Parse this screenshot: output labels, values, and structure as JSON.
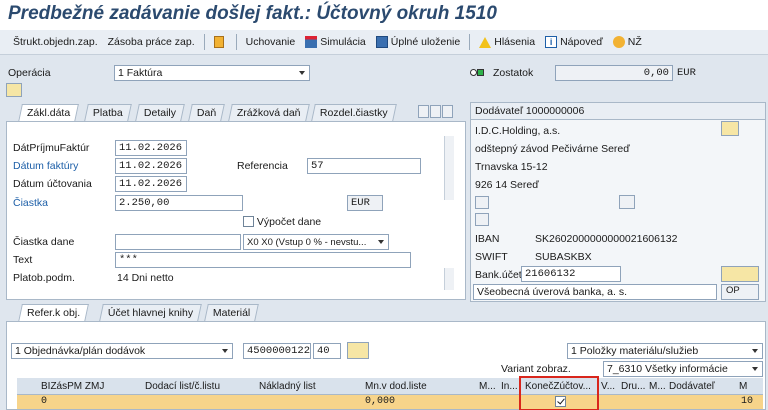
{
  "title": "Predbežné zadávanie došlej fakt.: Účtovný okruh 1510",
  "toolbar": {
    "items": [
      {
        "label": "Štrukt.objedn.zap."
      },
      {
        "label": "Zásoba práce zap."
      },
      {
        "label": "Uchovanie"
      },
      {
        "label": "Simulácia"
      },
      {
        "label": "Úplné uloženie"
      },
      {
        "label": "Hlásenia"
      },
      {
        "label": "Nápoveď"
      },
      {
        "label": "NŽ"
      }
    ]
  },
  "header": {
    "operation_label": "Operácia",
    "operation_value": "1 Faktúra",
    "balance_label": "Zostatok",
    "balance_value": "0,00",
    "balance_currency": "EUR"
  },
  "tabs": {
    "labels": [
      "Zákl.dáta",
      "Platba",
      "Detaily",
      "Daň",
      "Zrážková daň",
      "Rozdel.čiastky"
    ]
  },
  "basic": {
    "invoice_receipt_date_label": "DátPríjmuFaktúr",
    "invoice_receipt_date_value": "11.02.2026",
    "invoice_date_label": "Dátum faktúry",
    "invoice_date_value": "11.02.2026",
    "reference_label": "Referencia",
    "reference_value": "57",
    "posting_date_label": "Dátum účtovania",
    "posting_date_value": "11.02.2026",
    "amount_label": "Čiastka",
    "amount_value": "2.250,00",
    "amount_currency": "EUR",
    "calc_tax_label": "Výpočet dane",
    "tax_amount_label": "Čiastka dane",
    "tax_code_value": "X0 X0 (Vstup 0 % - nevstu...",
    "text_label": "Text",
    "text_value": "***",
    "payment_terms_label": "Platob.podm.",
    "payment_terms_value": "14 Dni netto"
  },
  "vendor": {
    "heading": "Dodávateľ 1000000006",
    "name": "I.D.C.Holding, a.s.",
    "branch": "odštepný závod Pečivárne Sereď",
    "street": "Trnavska 15-12",
    "city": "926 14 Sereď",
    "iban_label": "IBAN",
    "iban_value": "SK2602000000000021606132",
    "swift_label": "SWIFT",
    "swift_value": "SUBASKBX",
    "bank_account_label": "Bank.účet",
    "bank_account_value": "21606132",
    "bank_name": "Všeobecná úverová banka, a. s.",
    "op_label": "OP"
  },
  "lower_tabs": {
    "labels": [
      "Refer.k obj.",
      "Účet hlavnej knihy",
      "Materiál"
    ]
  },
  "ref": {
    "doc_type_value": "1 Objednávka/plán dodávok",
    "po_number": "4500000122",
    "po_item": "40",
    "layout_select_value": "1 Položky materiálu/služieb",
    "variant_label": "Variant zobraz.",
    "variant_value": "7_6310 Všetky informácie"
  },
  "grid": {
    "columns": [
      "BIZásPM ZMJ",
      "Dodací list/č.listu",
      "Nákladný list",
      "Mn.v dod.liste",
      "M...",
      "In...",
      "KonečZúčtov...",
      "V...",
      "Dru...",
      "M...",
      "Dodávateľ",
      "M"
    ],
    "row": {
      "col0": "0",
      "qty": "0,000",
      "final_invoice_checked": true,
      "last": "10"
    }
  }
}
